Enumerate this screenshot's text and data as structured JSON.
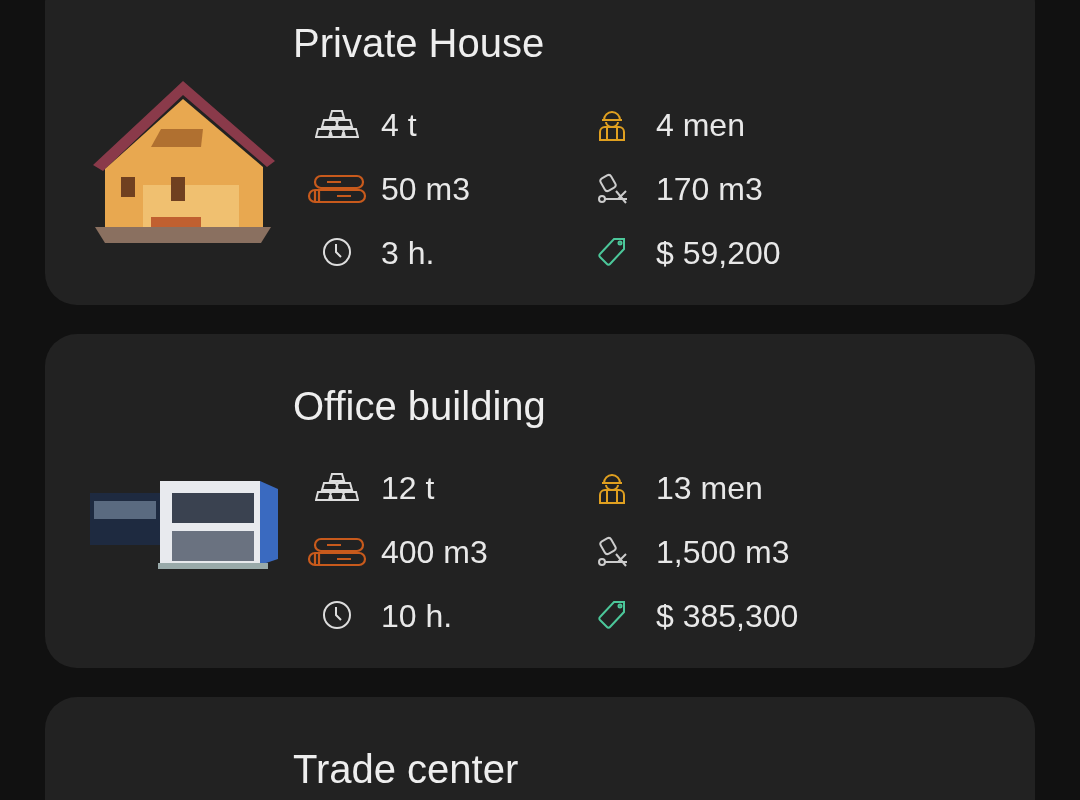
{
  "buildings": [
    {
      "title": "Private House",
      "kind": "house",
      "stats": [
        {
          "kind": "steel",
          "value": "4 t"
        },
        {
          "kind": "workers",
          "value": "4 men"
        },
        {
          "kind": "timber",
          "value": "50 m3"
        },
        {
          "kind": "concrete",
          "value": "170 m3"
        },
        {
          "kind": "time",
          "value": "3 h."
        },
        {
          "kind": "price",
          "value": "$ 59,200"
        }
      ]
    },
    {
      "title": "Office building",
      "kind": "office",
      "stats": [
        {
          "kind": "steel",
          "value": "12 t"
        },
        {
          "kind": "workers",
          "value": "13 men"
        },
        {
          "kind": "timber",
          "value": "400 m3"
        },
        {
          "kind": "concrete",
          "value": "1,500 m3"
        },
        {
          "kind": "time",
          "value": "10 h."
        },
        {
          "kind": "price",
          "value": "$ 385,300"
        }
      ]
    },
    {
      "title": "Trade center"
    }
  ]
}
